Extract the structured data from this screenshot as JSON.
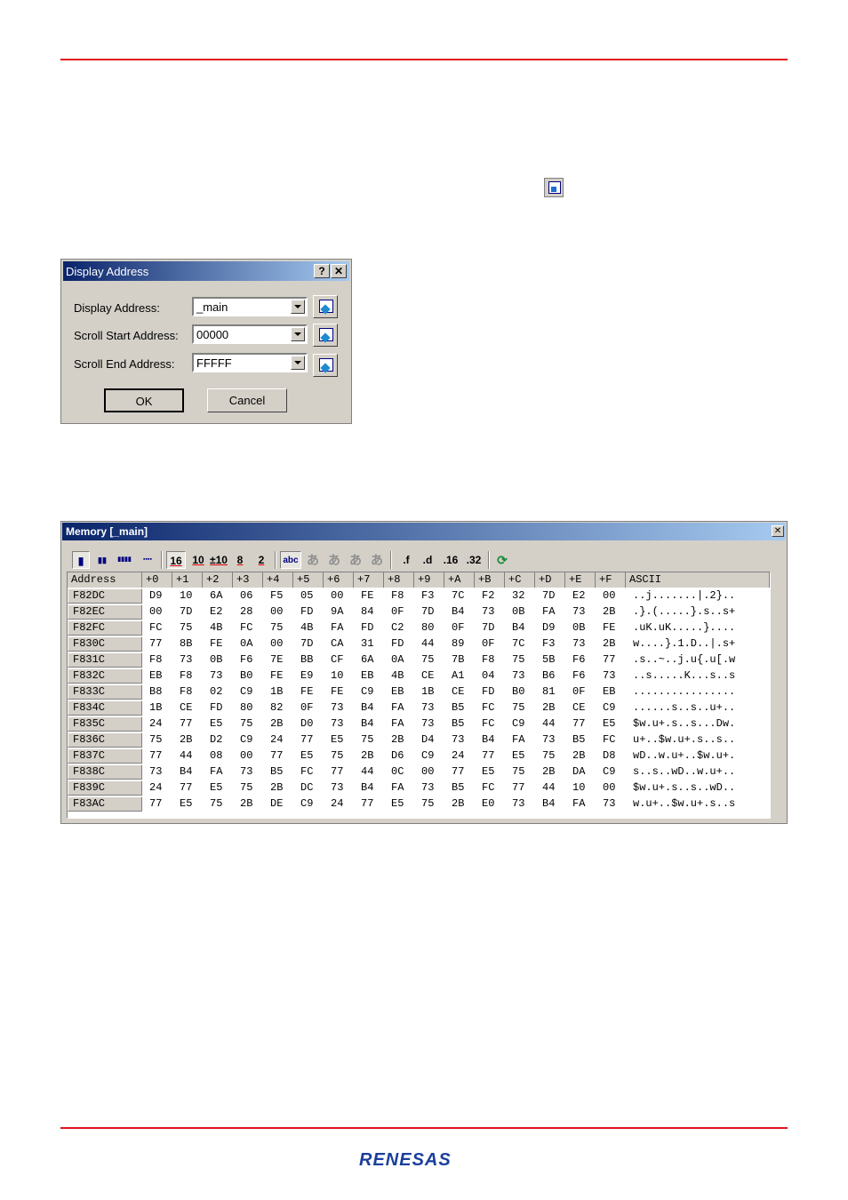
{
  "dialog": {
    "title": "Display Address",
    "help_btn": "?",
    "close_btn": "✕",
    "fields": [
      {
        "label": "Display Address:",
        "value": "_main"
      },
      {
        "label": "Scroll Start Address:",
        "value": "00000"
      },
      {
        "label": "Scroll End Address:",
        "value": "FFFFF"
      }
    ],
    "ok_label": "OK",
    "cancel_label": "Cancel"
  },
  "memory": {
    "title": "Memory [_main]",
    "close_btn": "✕",
    "toolbar": {
      "size_buttons": [
        "▮",
        "▮▮",
        "▮▮▮▮",
        "▪▪▪▪"
      ],
      "radix_buttons": [
        "16",
        "10",
        "±10",
        "8",
        "2"
      ],
      "char_buttons": [
        "abc",
        "あ",
        "あ",
        "あ",
        "あ"
      ],
      "float_buttons": [
        ".f",
        ".d",
        ".16",
        ".32"
      ],
      "refresh": "⟳"
    },
    "columns": [
      "Address",
      "+0",
      "+1",
      "+2",
      "+3",
      "+4",
      "+5",
      "+6",
      "+7",
      "+8",
      "+9",
      "+A",
      "+B",
      "+C",
      "+D",
      "+E",
      "+F",
      "ASCII"
    ],
    "rows": [
      {
        "addr": "F82DC",
        "bytes": [
          "D9",
          "10",
          "6A",
          "06",
          "F5",
          "05",
          "00",
          "FE",
          "F8",
          "F3",
          "7C",
          "F2",
          "32",
          "7D",
          "E2",
          "00"
        ],
        "ascii": "..j.......|.2}.."
      },
      {
        "addr": "F82EC",
        "bytes": [
          "00",
          "7D",
          "E2",
          "28",
          "00",
          "FD",
          "9A",
          "84",
          "0F",
          "7D",
          "B4",
          "73",
          "0B",
          "FA",
          "73",
          "2B"
        ],
        "ascii": ".}.(.....}.s..s+"
      },
      {
        "addr": "F82FC",
        "bytes": [
          "FC",
          "75",
          "4B",
          "FC",
          "75",
          "4B",
          "FA",
          "FD",
          "C2",
          "80",
          "0F",
          "7D",
          "B4",
          "D9",
          "0B",
          "FE"
        ],
        "ascii": ".uK.uK.....}...."
      },
      {
        "addr": "F830C",
        "bytes": [
          "77",
          "8B",
          "FE",
          "0A",
          "00",
          "7D",
          "CA",
          "31",
          "FD",
          "44",
          "89",
          "0F",
          "7C",
          "F3",
          "73",
          "2B"
        ],
        "ascii": "w....}.1.D..|.s+"
      },
      {
        "addr": "F831C",
        "bytes": [
          "F8",
          "73",
          "0B",
          "F6",
          "7E",
          "BB",
          "CF",
          "6A",
          "0A",
          "75",
          "7B",
          "F8",
          "75",
          "5B",
          "F6",
          "77"
        ],
        "ascii": ".s..~..j.u{.u[.w"
      },
      {
        "addr": "F832C",
        "bytes": [
          "EB",
          "F8",
          "73",
          "B0",
          "FE",
          "E9",
          "10",
          "EB",
          "4B",
          "CE",
          "A1",
          "04",
          "73",
          "B6",
          "F6",
          "73"
        ],
        "ascii": "..s.....K...s..s"
      },
      {
        "addr": "F833C",
        "bytes": [
          "B8",
          "F8",
          "02",
          "C9",
          "1B",
          "FE",
          "FE",
          "C9",
          "EB",
          "1B",
          "CE",
          "FD",
          "B0",
          "81",
          "0F",
          "EB"
        ],
        "ascii": "................"
      },
      {
        "addr": "F834C",
        "bytes": [
          "1B",
          "CE",
          "FD",
          "80",
          "82",
          "0F",
          "73",
          "B4",
          "FA",
          "73",
          "B5",
          "FC",
          "75",
          "2B",
          "CE",
          "C9"
        ],
        "ascii": "......s..s..u+.."
      },
      {
        "addr": "F835C",
        "bytes": [
          "24",
          "77",
          "E5",
          "75",
          "2B",
          "D0",
          "73",
          "B4",
          "FA",
          "73",
          "B5",
          "FC",
          "C9",
          "44",
          "77",
          "E5"
        ],
        "ascii": "$w.u+.s..s...Dw."
      },
      {
        "addr": "F836C",
        "bytes": [
          "75",
          "2B",
          "D2",
          "C9",
          "24",
          "77",
          "E5",
          "75",
          "2B",
          "D4",
          "73",
          "B4",
          "FA",
          "73",
          "B5",
          "FC"
        ],
        "ascii": "u+..$w.u+.s..s.."
      },
      {
        "addr": "F837C",
        "bytes": [
          "77",
          "44",
          "08",
          "00",
          "77",
          "E5",
          "75",
          "2B",
          "D6",
          "C9",
          "24",
          "77",
          "E5",
          "75",
          "2B",
          "D8"
        ],
        "ascii": "wD..w.u+..$w.u+."
      },
      {
        "addr": "F838C",
        "bytes": [
          "73",
          "B4",
          "FA",
          "73",
          "B5",
          "FC",
          "77",
          "44",
          "0C",
          "00",
          "77",
          "E5",
          "75",
          "2B",
          "DA",
          "C9"
        ],
        "ascii": "s..s..wD..w.u+.."
      },
      {
        "addr": "F839C",
        "bytes": [
          "24",
          "77",
          "E5",
          "75",
          "2B",
          "DC",
          "73",
          "B4",
          "FA",
          "73",
          "B5",
          "FC",
          "77",
          "44",
          "10",
          "00"
        ],
        "ascii": "$w.u+.s..s..wD.."
      },
      {
        "addr": "F83AC",
        "bytes": [
          "77",
          "E5",
          "75",
          "2B",
          "DE",
          "C9",
          "24",
          "77",
          "E5",
          "75",
          "2B",
          "E0",
          "73",
          "B4",
          "FA",
          "73"
        ],
        "ascii": "w.u+..$w.u+.s..s"
      }
    ]
  },
  "footer": {
    "logo": "RENESAS"
  },
  "colors": {
    "rule": "#e0161c",
    "title_gradient_start": "#0a246a",
    "title_gradient_end": "#a6caf0",
    "logo": "#1a3f9c"
  }
}
